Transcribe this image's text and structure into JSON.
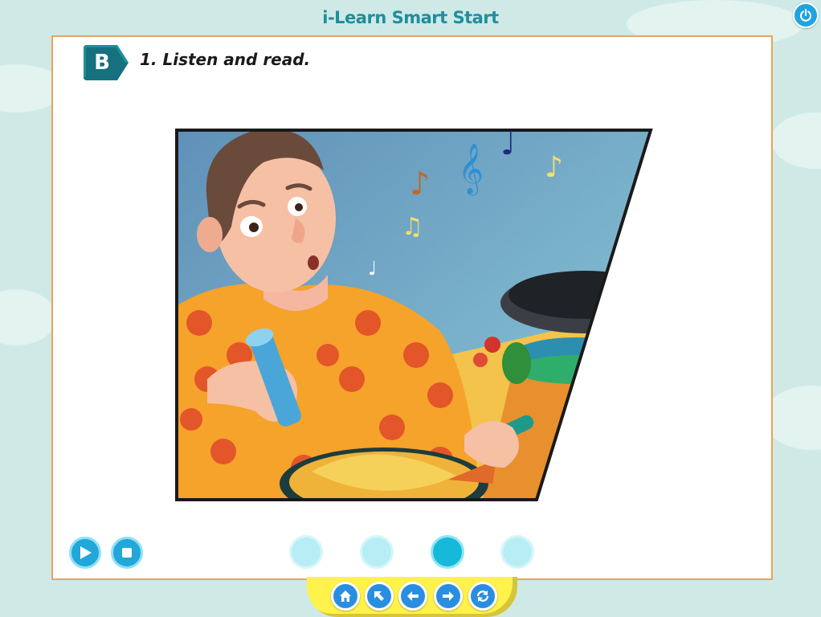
{
  "header": {
    "app_title": "i-Learn Smart Start",
    "power_icon": "power-icon"
  },
  "lesson": {
    "section_letter": "B",
    "instruction": "1. Listen and read."
  },
  "illustration": {
    "subject": "man-seasoning-fish-icon"
  },
  "audio_controls": {
    "play_icon": "play-icon",
    "stop_icon": "stop-icon"
  },
  "pagination": {
    "total_pages": 4,
    "active_page": 3
  },
  "bottom_nav": {
    "items": [
      "home-icon",
      "up-left-arrow-icon",
      "back-arrow-icon",
      "forward-arrow-icon",
      "refresh-icon"
    ]
  },
  "colors": {
    "background": "#cfe9e6",
    "accent_teal": "#1f8e9d",
    "card_border": "#f0a05a",
    "button_blue": "#22a7d9",
    "nav_yellow": "#fff24a"
  }
}
